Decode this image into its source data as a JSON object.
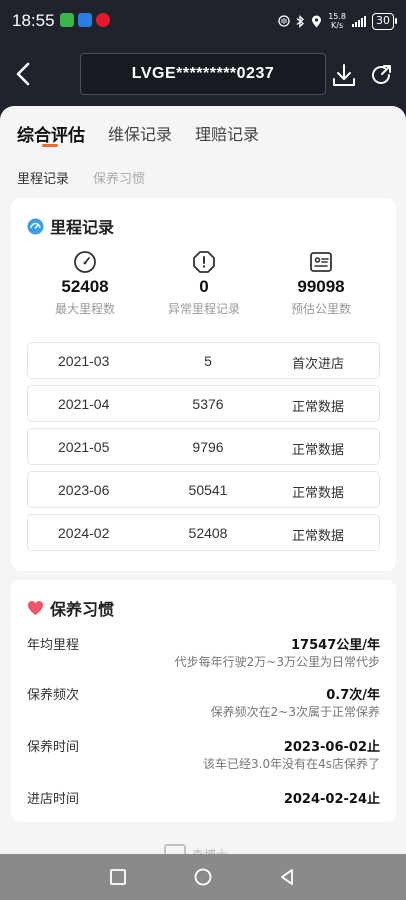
{
  "status_bar": {
    "time": "18:55",
    "net_speed_value": "15.8",
    "net_speed_unit": "K/s",
    "battery": "30"
  },
  "header": {
    "vin": "LVGE*********0237"
  },
  "tabs": [
    {
      "label": "综合评估",
      "active": true
    },
    {
      "label": "维保记录",
      "active": false
    },
    {
      "label": "理赔记录",
      "active": false
    }
  ],
  "subtabs": [
    {
      "label": "里程记录",
      "active": true
    },
    {
      "label": "保养习惯",
      "active": false
    }
  ],
  "mileage_card": {
    "title": "里程记录",
    "stats": [
      {
        "value": "52408",
        "label": "最大里程数",
        "icon": "gauge-icon"
      },
      {
        "value": "0",
        "label": "异常里程记录",
        "icon": "alert-octagon-icon"
      },
      {
        "value": "99098",
        "label": "预估公里数",
        "icon": "id-card-icon"
      }
    ],
    "rows": [
      {
        "date": "2021-03",
        "km": "5",
        "status": "首次进店"
      },
      {
        "date": "2021-04",
        "km": "5376",
        "status": "正常数据"
      },
      {
        "date": "2021-05",
        "km": "9796",
        "status": "正常数据"
      },
      {
        "date": "2023-06",
        "km": "50541",
        "status": "正常数据"
      },
      {
        "date": "2024-02",
        "km": "52408",
        "status": "正常数据"
      }
    ]
  },
  "habit_card": {
    "title": "保养习惯",
    "rows": [
      {
        "label": "年均里程",
        "value": "17547公里/年",
        "desc": "代步每年行驶2万~3万公里为日常代步"
      },
      {
        "label": "保养频次",
        "value": "0.7次/年",
        "desc": "保养频次在2~3次属于正常保养"
      },
      {
        "label": "保养时间",
        "value": "2023-06-02止",
        "desc": "该车已经3.0年没有在4s店保养了"
      },
      {
        "label": "进店时间",
        "value": "2024-02-24止",
        "desc": ""
      }
    ]
  },
  "watermark": {
    "text": "查博士"
  },
  "colors": {
    "accent": "#f06a2b",
    "header_bg": "#1f232b",
    "page_bg": "#f5f5f5"
  }
}
